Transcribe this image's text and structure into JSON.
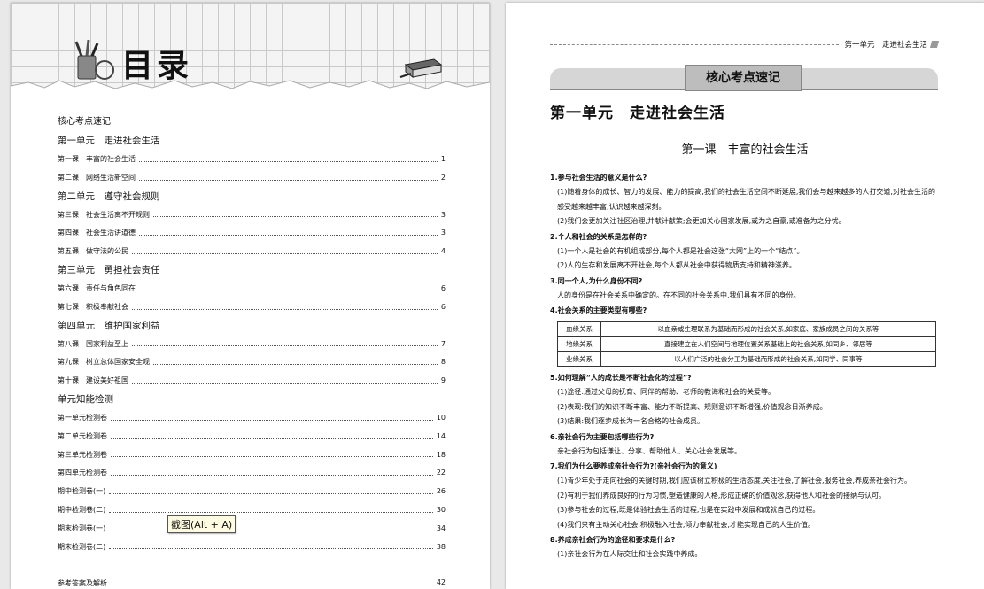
{
  "left": {
    "title": "目录",
    "toc_header": "核心考点速记",
    "units": [
      {
        "title": "第一单元　走进社会生活",
        "lessons": [
          {
            "label": "第一课　丰富的社会生活",
            "page": "1"
          },
          {
            "label": "第二课　网络生活新空间",
            "page": "2"
          }
        ]
      },
      {
        "title": "第二单元　遵守社会规则",
        "lessons": [
          {
            "label": "第三课　社会生活离不开规则",
            "page": "3"
          },
          {
            "label": "第四课　社会生活讲道德",
            "page": "3"
          },
          {
            "label": "第五课　做守法的公民",
            "page": "4"
          }
        ]
      },
      {
        "title": "第三单元　勇担社会责任",
        "lessons": [
          {
            "label": "第六课　责任与角色同在",
            "page": "6"
          },
          {
            "label": "第七课　积极奉献社会",
            "page": "6"
          }
        ]
      },
      {
        "title": "第四单元　维护国家利益",
        "lessons": [
          {
            "label": "第八课　国家利益至上",
            "page": "7"
          },
          {
            "label": "第九课　树立总体国家安全观",
            "page": "8"
          },
          {
            "label": "第十课　建设美好祖国",
            "page": "9"
          }
        ]
      },
      {
        "title": "单元知能检测",
        "lessons": [
          {
            "label": "第一单元检测卷",
            "page": "10"
          },
          {
            "label": "第二单元检测卷",
            "page": "14"
          },
          {
            "label": "第三单元检测卷",
            "page": "18"
          },
          {
            "label": "第四单元检测卷",
            "page": "22"
          },
          {
            "label": "期中检测卷(一)",
            "page": "26"
          },
          {
            "label": "期中检测卷(二)",
            "page": "30"
          },
          {
            "label": "期末检测卷(一)",
            "page": "34"
          },
          {
            "label": "期末检测卷(二)",
            "page": "38"
          }
        ]
      }
    ],
    "answers": {
      "label": "参考答案及解析",
      "page": "42"
    },
    "tooltip": "截图(Alt + A)"
  },
  "right": {
    "running_header": "第一单元　走进社会生活",
    "section_banner": "核心考点速记",
    "unit_title": "第一单元　走进社会生活",
    "lesson_title": "第一课　丰富的社会生活",
    "q1": "1.参与社会生活的意义是什么?",
    "q1_a1": "(1)随着身体的成长、智力的发展、能力的提高,我们的社会生活空间不断延展,我们会与越来越多的人打交道,对社会生活的感受越来越丰富,认识越来越深刻。",
    "q1_a2": "(2)我们会更加关注社区治理,并献计献策;会更加关心国家发展,或为之自豪,或准备为之分忧。",
    "q2": "2.个人和社会的关系是怎样的?",
    "q2_a1": "(1)一个人是社会的有机组成部分,每个人都是社会这张“大网”上的一个“结点”。",
    "q2_a2": "(2)人的生存和发展离不开社会,每个人都从社会中获得物质支持和精神滋养。",
    "q3": "3.同一个人,为什么身份不同?",
    "q3_a1": "人的身份是在社会关系中确定的。在不同的社会关系中,我们具有不同的身份。",
    "q4": "4.社会关系的主要类型有哪些?",
    "relations": [
      {
        "k": "血缘关系",
        "v": "以血亲或生理联系为基础而形成的社会关系,如家庭、家族成员之间的关系等"
      },
      {
        "k": "地缘关系",
        "v": "直接建立在人们空间与地理位置关系基础上的社会关系,如同乡、邻居等"
      },
      {
        "k": "业缘关系",
        "v": "以人们广泛的社会分工为基础而形成的社会关系,如同学、同事等"
      }
    ],
    "q5": "5.如何理解“人的成长是不断社会化的过程”?",
    "q5_a1": "(1)途径:通过父母的抚育、同伴的帮助、老师的教诲和社会的关爱等。",
    "q5_a2": "(2)表现:我们的知识不断丰富、能力不断提高、规则意识不断增强,价值观念日渐养成。",
    "q5_a3": "(3)结果:我们逐步成长为一名合格的社会成员。",
    "q6": "6.亲社会行为主要包括哪些行为?",
    "q6_a1": "亲社会行为包括谦让、分享、帮助他人、关心社会发展等。",
    "q7": "7.我们为什么要养成亲社会行为?(亲社会行为的意义)",
    "q7_a1": "(1)青少年处于走向社会的关键时期,我们应该树立积极的生活态度,关注社会,了解社会,服务社会,养成亲社会行为。",
    "q7_a2": "(2)有利于我们养成良好的行为习惯,塑造健康的人格,形成正确的价值观念,获得他人和社会的接纳与认可。",
    "q7_a3": "(3)参与社会的过程,既是体验社会生活的过程,也是在实践中发展和成就自己的过程。",
    "q7_a4": "(4)我们只有主动关心社会,积极融入社会,倾力奉献社会,才能实现自己的人生价值。",
    "q8": "8.养成亲社会行为的途径和要求是什么?",
    "q8_a1": "(1)亲社会行为在人际交往和社会实践中养成。"
  }
}
